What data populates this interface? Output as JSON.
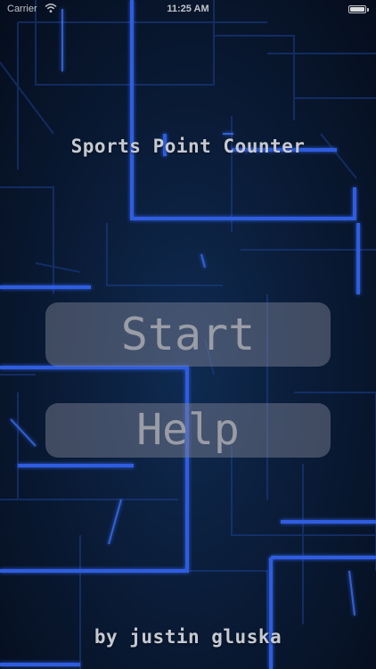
{
  "status_bar": {
    "carrier": "Carrier",
    "wifi_icon": "wifi-icon",
    "time": "11:25 AM",
    "battery_icon": "battery-icon",
    "battery_level": 1.0
  },
  "screen": {
    "title": "Sports Point Counter",
    "start_label": "Start",
    "help_label": "Help",
    "credit": "by justin gluska"
  },
  "colors": {
    "background": "#081425",
    "circuit_lines": "#2f5fe0",
    "button_fill": "#7d8294",
    "button_text": "#9a9da6",
    "title_text": "#c6c9d0"
  }
}
